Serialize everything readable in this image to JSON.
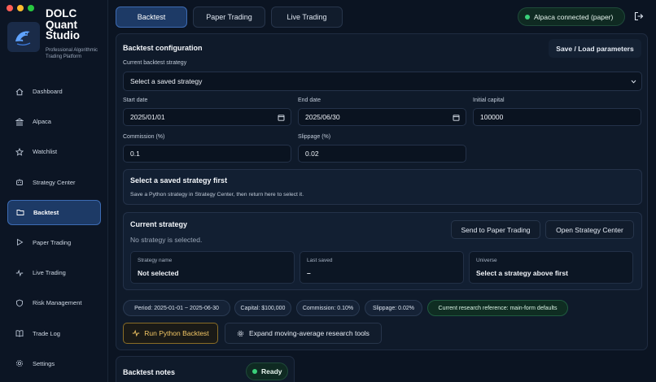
{
  "brand": {
    "title": "DOLC Quant Studio",
    "subtitle": "Professional Algorithmic Trading Platform"
  },
  "sidebar": {
    "items": [
      {
        "label": "Dashboard",
        "icon": "home-icon"
      },
      {
        "label": "Alpaca",
        "icon": "bank-icon"
      },
      {
        "label": "Watchlist",
        "icon": "star-icon"
      },
      {
        "label": "Strategy Center",
        "icon": "robot-icon"
      },
      {
        "label": "Backtest",
        "icon": "folder-icon",
        "active": true
      },
      {
        "label": "Paper Trading",
        "icon": "play-icon"
      },
      {
        "label": "Live Trading",
        "icon": "activity-icon"
      },
      {
        "label": "Risk Management",
        "icon": "shield-icon"
      },
      {
        "label": "Trade Log",
        "icon": "book-icon"
      },
      {
        "label": "Settings",
        "icon": "gear-icon"
      }
    ]
  },
  "tabs": [
    {
      "label": "Backtest",
      "active": true
    },
    {
      "label": "Paper Trading"
    },
    {
      "label": "Live Trading"
    }
  ],
  "connection": {
    "text": "Alpaca connected (paper)",
    "status_color": "#3ad07a"
  },
  "config": {
    "title": "Backtest configuration",
    "save_load": "Save / Load parameters",
    "strategy_label": "Current backtest strategy",
    "strategy_value": "Select a saved strategy",
    "start_label": "Start date",
    "start_value": "2025/01/01",
    "end_label": "End date",
    "end_value": "2025/06/30",
    "capital_label": "Initial capital",
    "capital_value": "100000",
    "commission_label": "Commission (%)",
    "commission_value": "0.1",
    "slippage_label": "Slippage (%)",
    "slippage_value": "0.02"
  },
  "notice": {
    "title": "Select a saved strategy first",
    "body": "Save a Python strategy in Strategy Center, then return here to select it."
  },
  "current": {
    "title": "Current strategy",
    "empty": "No strategy is selected.",
    "send_btn": "Send to Paper Trading",
    "open_btn": "Open Strategy Center",
    "name_label": "Strategy name",
    "name_value": "Not selected",
    "saved_label": "Last saved",
    "saved_value": "–",
    "universe_label": "Universe",
    "universe_value": "Select a strategy above first"
  },
  "chips": {
    "period": "Period: 2025-01-01 ~ 2025-06-30",
    "capital": "Capital: $100,000",
    "commission": "Commission: 0.10%",
    "slippage": "Slippage: 0.02%",
    "reference": "Current research reference: main-form defaults"
  },
  "actions": {
    "run": "Run Python Backtest",
    "expand": "Expand moving-average research tools"
  },
  "notes": {
    "title": "Backtest notes",
    "status": "Ready"
  },
  "colors": {
    "accent": "#3d6bb3",
    "run_border": "#b08a2e",
    "run_text": "#f3c765",
    "green": "#3ad07a"
  }
}
